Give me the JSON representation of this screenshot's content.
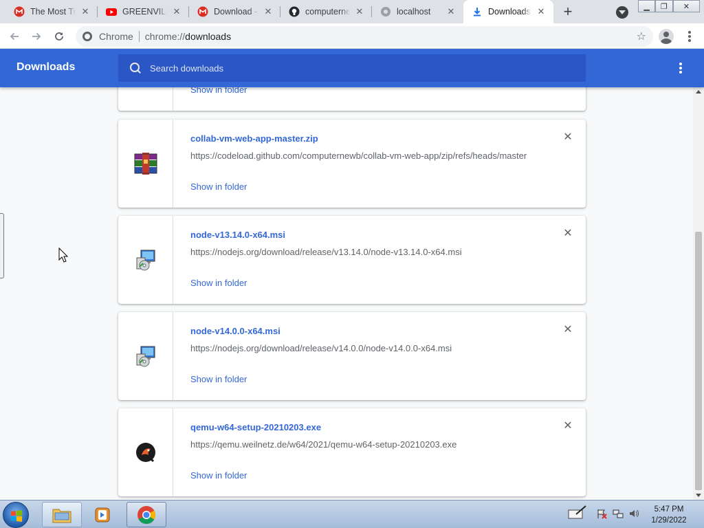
{
  "tabs": [
    {
      "title": "The Most Trusted",
      "icon": "gmail-icon",
      "active": false
    },
    {
      "title": "GREENVILLE",
      "icon": "youtube-icon",
      "active": false
    },
    {
      "title": "Download - Gmail",
      "icon": "gmail-icon",
      "active": false
    },
    {
      "title": "computernewb",
      "icon": "github-icon",
      "active": false
    },
    {
      "title": "localhost",
      "icon": "globe-icon",
      "active": false
    },
    {
      "title": "Downloads",
      "icon": "download-icon",
      "active": true
    }
  ],
  "toolbar": {
    "omnibox_label": "Chrome",
    "url_scheme": "chrome://",
    "url_host": "downloads"
  },
  "header": {
    "title": "Downloads",
    "search_placeholder": "Search downloads"
  },
  "downloads": [
    {
      "name": "",
      "url": "",
      "action": "Show in folder",
      "icon": "file-icon"
    },
    {
      "name": "collab-vm-web-app-master.zip",
      "url": "https://codeload.github.com/computernewb/collab-vm-web-app/zip/refs/heads/master",
      "action": "Show in folder",
      "icon": "winrar-archive-icon"
    },
    {
      "name": "node-v13.14.0-x64.msi",
      "url": "https://nodejs.org/download/release/v13.14.0/node-v13.14.0-x64.msi",
      "action": "Show in folder",
      "icon": "msi-installer-icon"
    },
    {
      "name": "node-v14.0.0-x64.msi",
      "url": "https://nodejs.org/download/release/v14.0.0/node-v14.0.0-x64.msi",
      "action": "Show in folder",
      "icon": "msi-installer-icon"
    },
    {
      "name": "qemu-w64-setup-20210203.exe",
      "url": "https://qemu.weilnetz.de/w64/2021/qemu-w64-setup-20210203.exe",
      "action": "Show in folder",
      "icon": "qemu-icon"
    }
  ],
  "taskbar": {
    "time": "5:47 PM",
    "date": "1/29/2022"
  },
  "colors": {
    "accent": "#3367d6",
    "link": "#3367d6",
    "page_bg": "#f8f9fa"
  }
}
